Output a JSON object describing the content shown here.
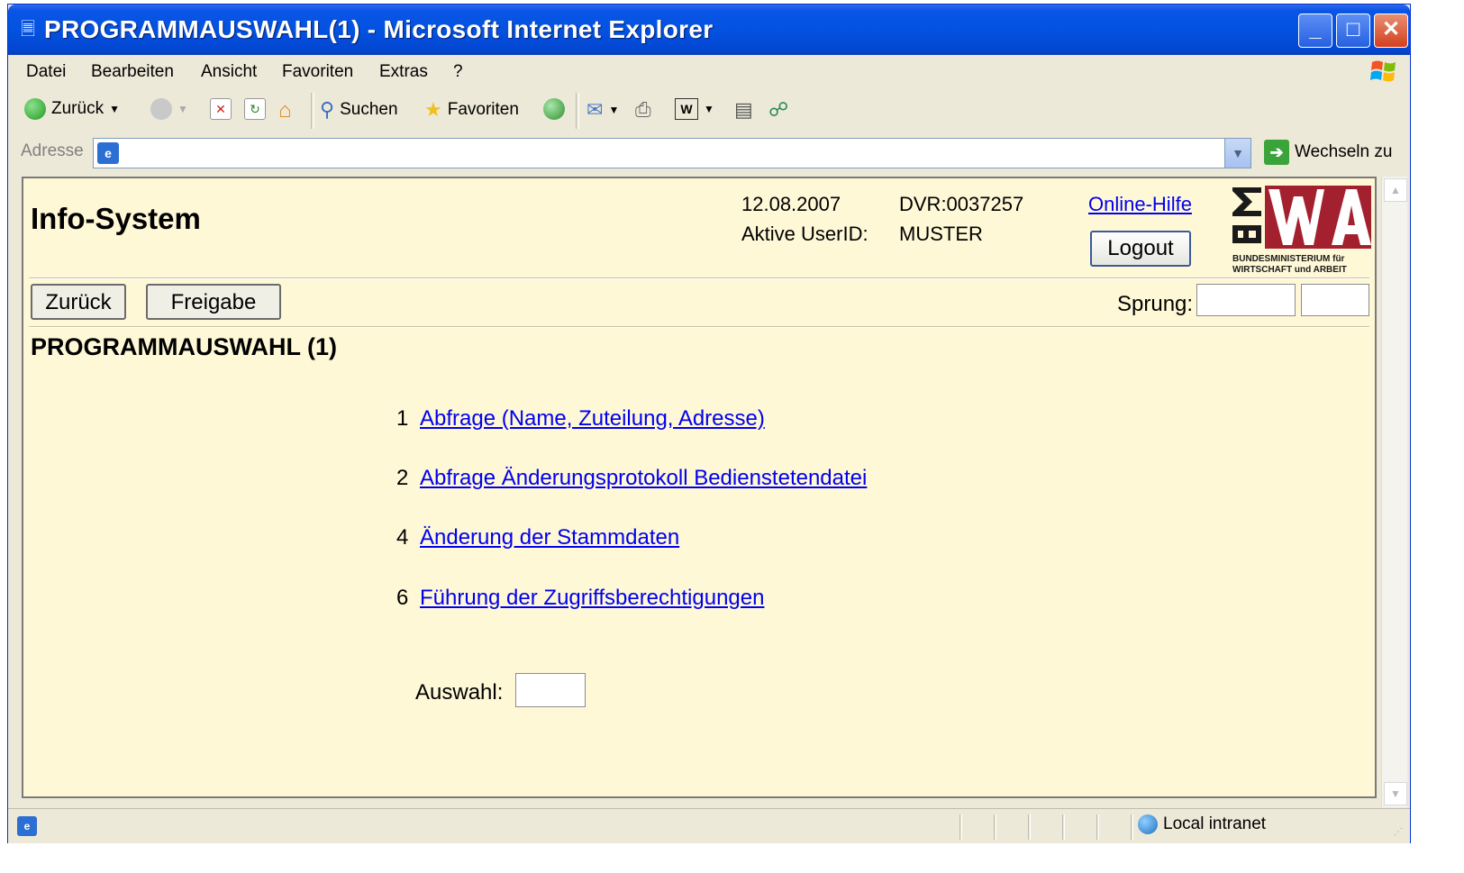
{
  "window": {
    "title": "PROGRAMMAUSWAHL(1) - Microsoft Internet Explorer",
    "minimize": "_",
    "maximize": "□",
    "close": "✕"
  },
  "menubar": {
    "items": [
      "Datei",
      "Bearbeiten",
      "Ansicht",
      "Favoriten",
      "Extras",
      "?"
    ]
  },
  "toolbar": {
    "back": "Zurück",
    "search": "Suchen",
    "favorites": "Favoriten"
  },
  "addressbar": {
    "label": "Adresse",
    "value": "",
    "go": "Wechseln zu"
  },
  "header": {
    "app_title": "Info-System",
    "date": "12.08.2007",
    "dvr": "DVR:0037257",
    "user_label": "Aktive UserID:",
    "user_value": "MUSTER",
    "help": "Online-Hilfe",
    "logout": "Logout",
    "logo_caption_1": "BUNDESMINISTERIUM für",
    "logo_caption_2": "WIRTSCHAFT und ARBEIT"
  },
  "actions": {
    "back": "Zurück",
    "release": "Freigabe",
    "jump_label": "Sprung:"
  },
  "page": {
    "heading": "PROGRAMMAUSWAHL (1)",
    "options": [
      {
        "num": "1",
        "label": "Abfrage (Name, Zuteilung, Adresse)"
      },
      {
        "num": "2",
        "label": "Abfrage Änderungsprotokoll Bedienstetendatei"
      },
      {
        "num": "4",
        "label": "Änderung der Stammdaten"
      },
      {
        "num": "6",
        "label": "Führung der Zugriffsberechtigungen"
      }
    ],
    "choice_label": "Auswahl:"
  },
  "status": {
    "zone": "Local intranet"
  },
  "colors": {
    "content_bg": "#fff8d7",
    "link": "#0000ee",
    "logo_red": "#a3202f"
  }
}
